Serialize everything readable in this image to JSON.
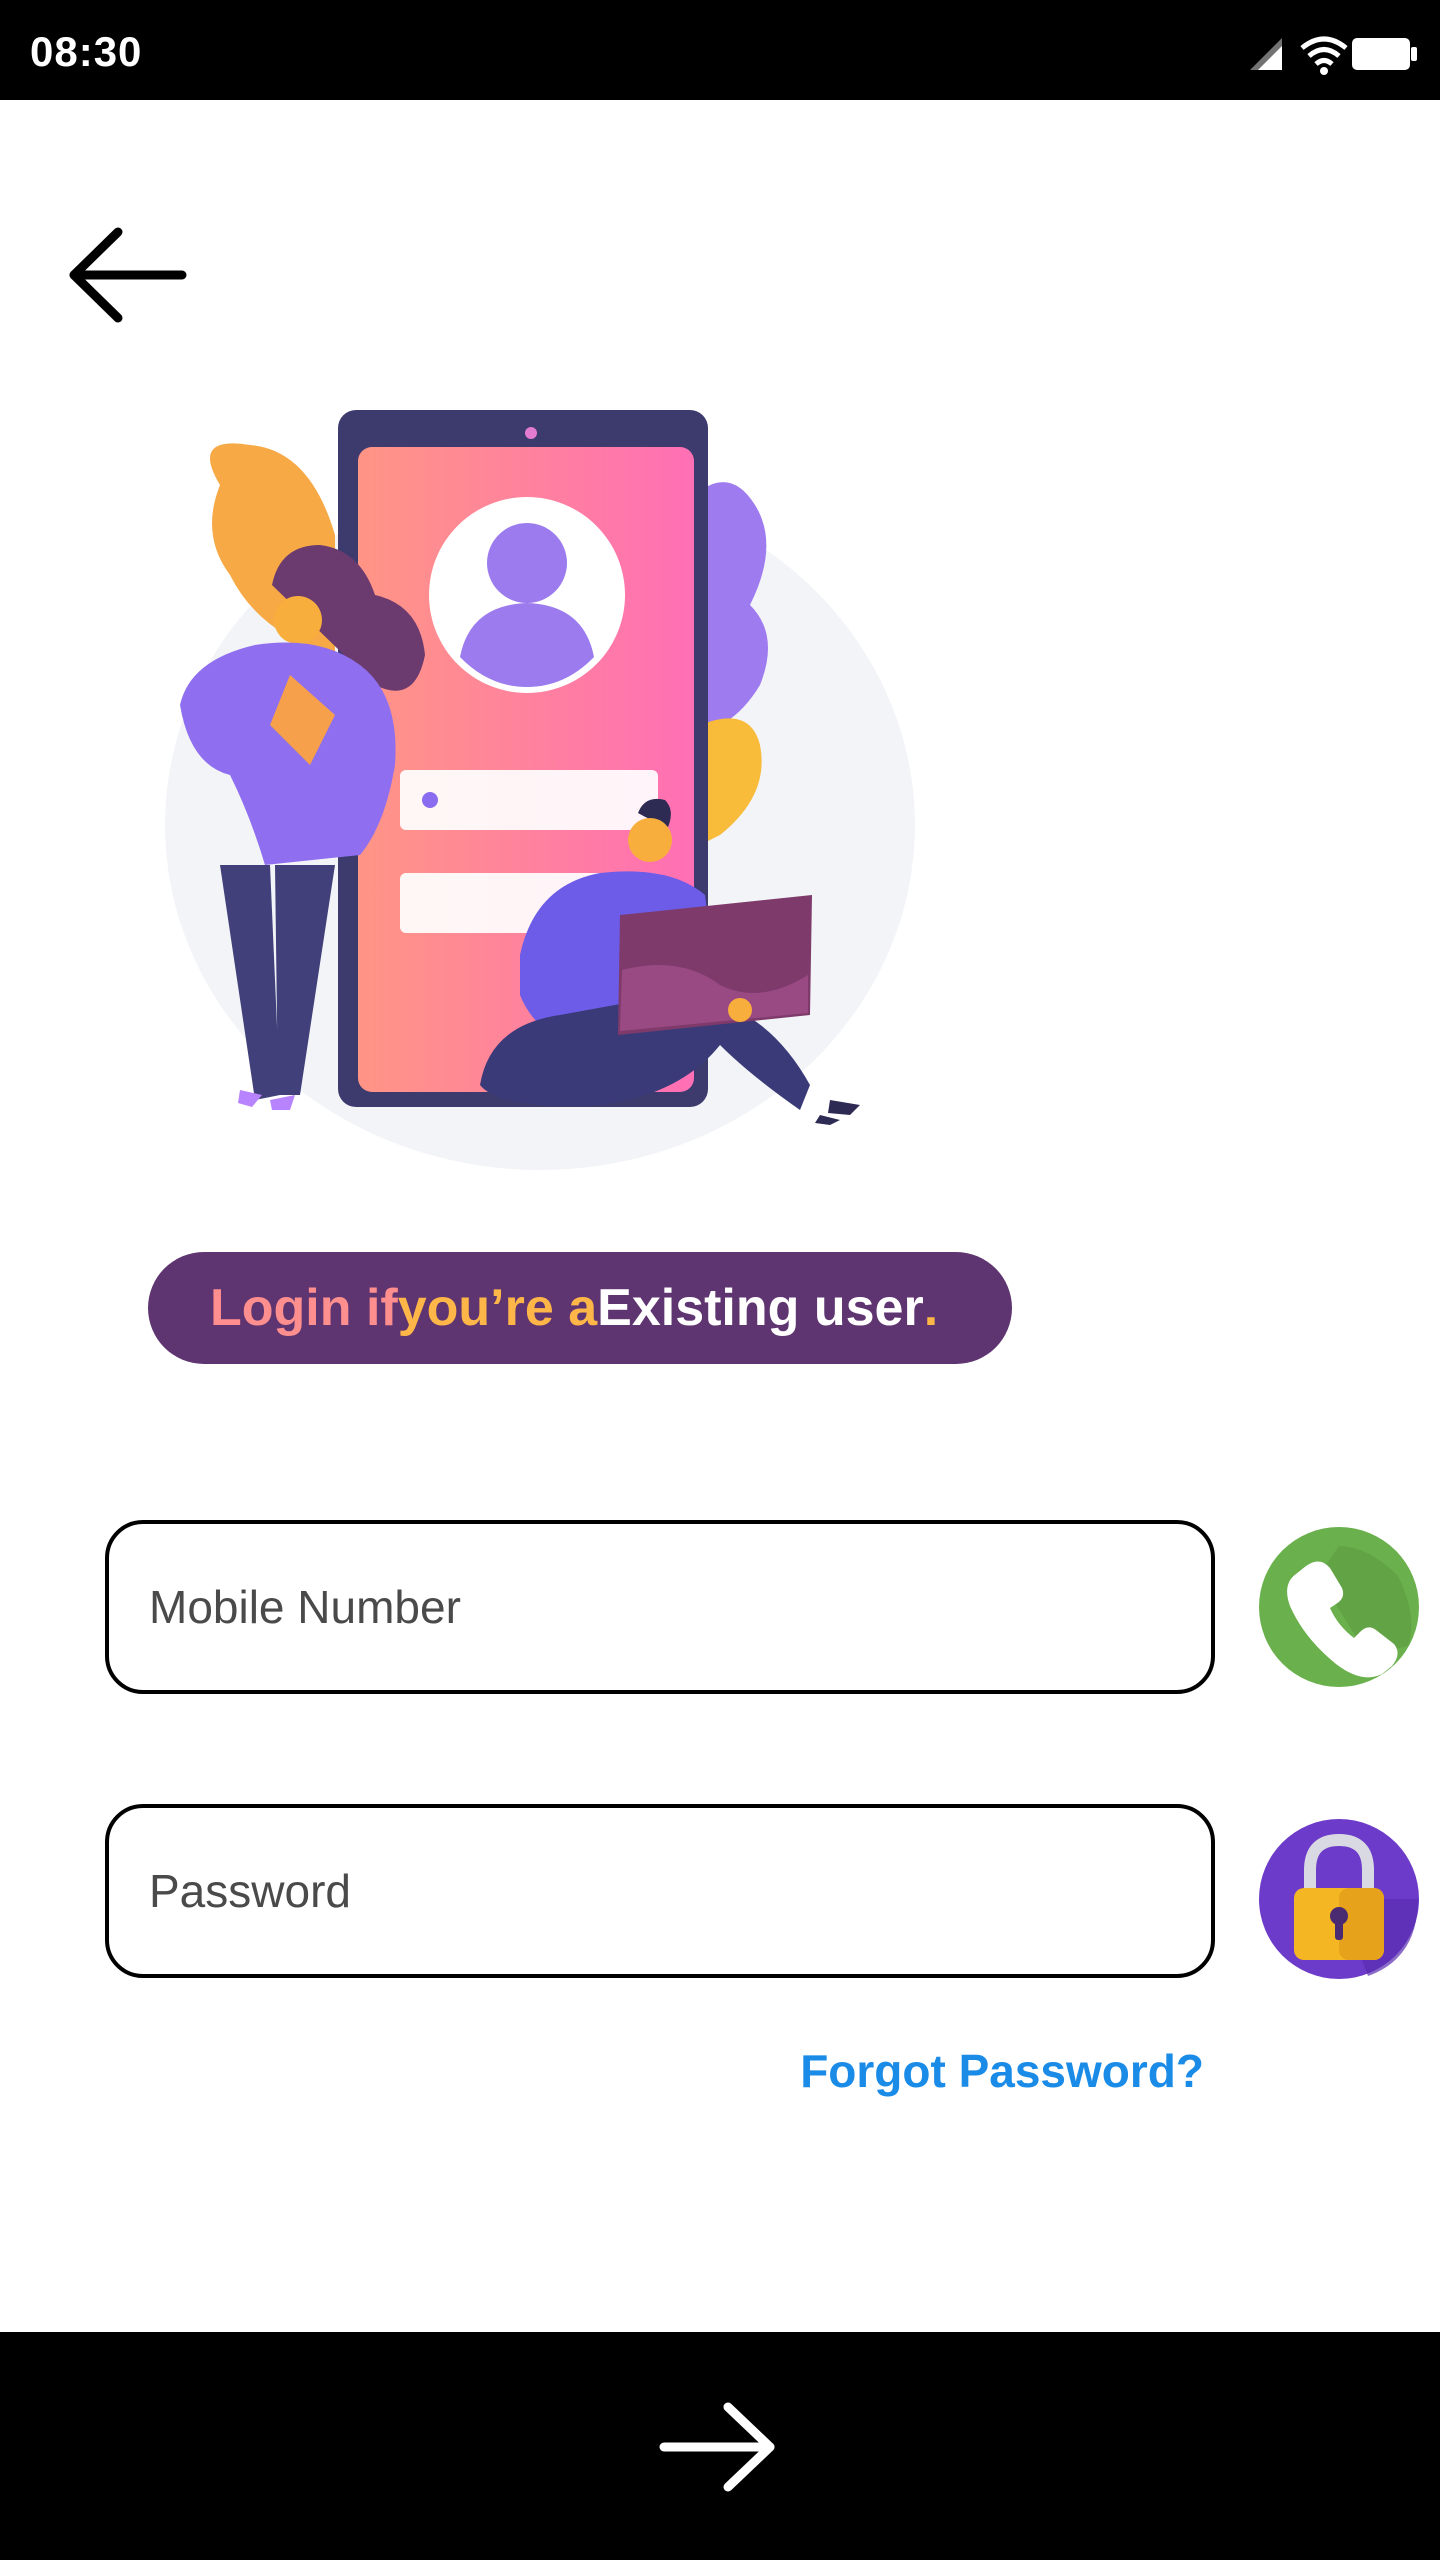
{
  "status_bar": {
    "time": "08:30",
    "icons": [
      "signal-icon",
      "wifi-icon",
      "battery-icon"
    ]
  },
  "header": {
    "back_icon": "arrow-left-icon"
  },
  "banner": {
    "segment_1": "Login if ",
    "segment_2": "you’re a ",
    "segment_3": "Existing user",
    "segment_4": ".",
    "background": "#5e3570"
  },
  "form": {
    "mobile": {
      "value": "",
      "placeholder": "Mobile Number",
      "icon": "phone-icon"
    },
    "password": {
      "value": "",
      "placeholder": "Password",
      "icon": "lock-icon"
    },
    "forgot_label": "Forgot Password?"
  },
  "footer": {
    "next_icon": "arrow-right-icon"
  },
  "colors": {
    "link": "#1a8be6",
    "phone_bg": "#6ab04c",
    "lock_bg": "#6d3bc9",
    "lock_body": "#f5b623"
  }
}
